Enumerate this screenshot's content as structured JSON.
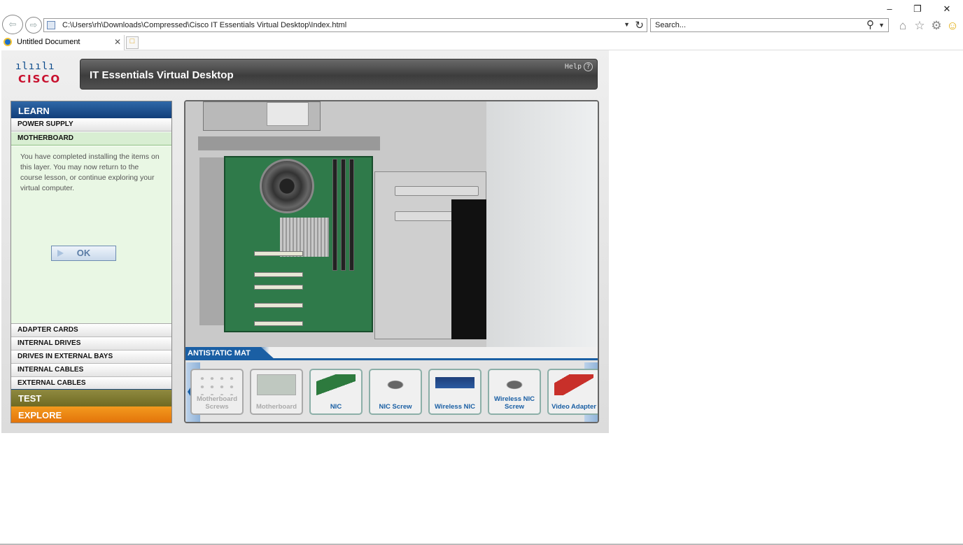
{
  "browser": {
    "address": "C:\\Users\\rh\\Downloads\\Compressed\\Cisco IT Essentials Virtual Desktop\\Index.html",
    "search_placeholder": "Search...",
    "tab_title": "Untitled Document",
    "window_controls": [
      "–",
      "❐",
      "✕"
    ]
  },
  "app": {
    "logo_bars": "ılıılı",
    "logo_word": "CISCO",
    "title": "IT Essentials Virtual Desktop",
    "help_label": "Help",
    "help_icon": "?"
  },
  "sidebar": {
    "learn_label": "LEARN",
    "items_top": [
      "POWER SUPPLY",
      "MOTHERBOARD"
    ],
    "message": "You have completed installing the items on this layer. You may now return to the course lesson, or continue exploring your virtual computer.",
    "ok_label": "OK",
    "items_bottom": [
      "ADAPTER CARDS",
      "INTERNAL DRIVES",
      "DRIVES IN EXTERNAL BAYS",
      "INTERNAL CABLES",
      "EXTERNAL CABLES"
    ],
    "test_label": "TEST",
    "explore_label": "EXPLORE"
  },
  "viewer": {
    "mat_label": "ANTISTATIC MAT",
    "tiles": [
      {
        "label": "Motherboard Screws",
        "state": "used"
      },
      {
        "label": "Motherboard",
        "state": "used"
      },
      {
        "label": "NIC",
        "state": "available"
      },
      {
        "label": "NIC Screw",
        "state": "available"
      },
      {
        "label": "Wireless NIC",
        "state": "available"
      },
      {
        "label": "Wireless NIC Screw",
        "state": "available"
      },
      {
        "label": "Video Adapter",
        "state": "available"
      }
    ]
  }
}
